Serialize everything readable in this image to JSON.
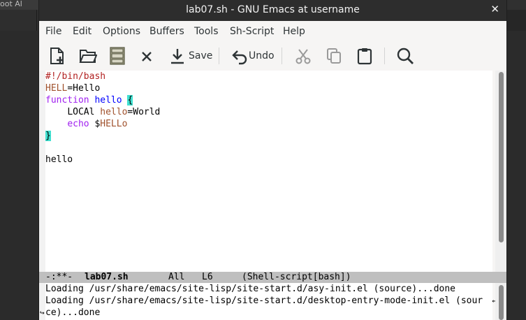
{
  "background_window": {
    "top_label": "oot Al",
    "up_icon": "chevron-up-icon"
  },
  "window": {
    "title": "lab07.sh - GNU Emacs at username",
    "close": "✕"
  },
  "menu": [
    "File",
    "Edit",
    "Options",
    "Buffers",
    "Tools",
    "Sh-Script",
    "Help"
  ],
  "toolbar": {
    "new_file": "new-file-icon",
    "open": "open-folder-icon",
    "dired": "save-disk-icon",
    "kill": "close-icon",
    "save_label": "Save",
    "undo_label": "Undo",
    "cut": "cut-icon",
    "copy": "copy-icon",
    "paste": "paste-icon",
    "search": "search-icon"
  },
  "editor": {
    "line1": "#!/bin/bash",
    "line2_var": "HELL",
    "line2_rest": "=Hello",
    "line3_kw": "function",
    "line3_fn": "hello",
    "line3_brace": "{",
    "line4_indent": "    ",
    "line4_local": "LOCAl ",
    "line4_var": "hello",
    "line4_rest": "=World",
    "line5_indent": "    ",
    "line5_echo": "echo",
    "line5_sp": " $",
    "line5_var": "HELLo",
    "line6_brace": "}",
    "line8": "hello"
  },
  "modeline": {
    "status": "-:**-",
    "buffer": "lab07.sh",
    "position": "All",
    "line": "L6",
    "mode": "(Shell-script[bash])"
  },
  "echo": {
    "line1": "Loading /usr/share/emacs/site-lisp/site-start.d/asy-init.el (source)...done",
    "line2": "Loading /usr/share/emacs/site-lisp/site-start.d/desktop-entry-mode-init.el (sour",
    "line3": "ce)...done"
  },
  "colors": {
    "comment": "#b22222",
    "variable": "#a0522d",
    "keyword": "#a020f0",
    "function": "#0000ff",
    "paren_match": "#40e0d0",
    "modeline_bg": "#bfbfbf"
  }
}
